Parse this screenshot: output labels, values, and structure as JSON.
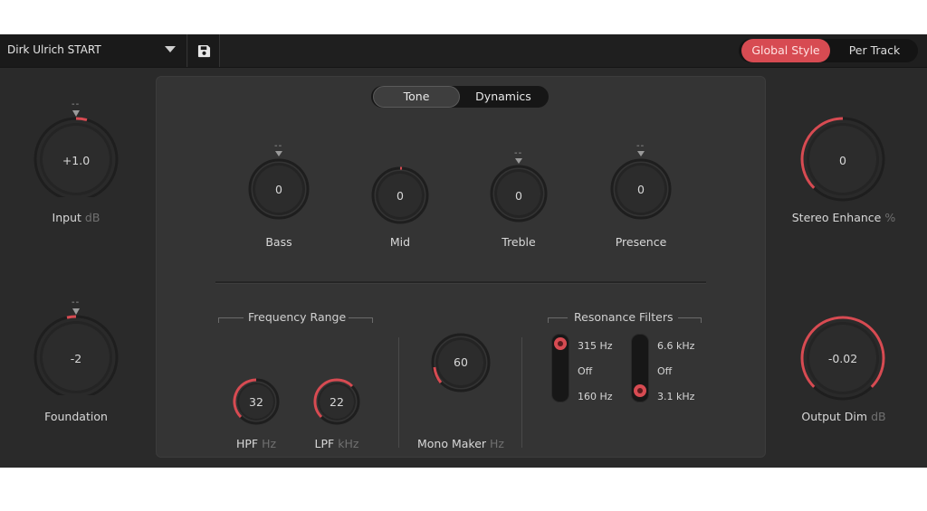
{
  "topbar": {
    "preset_name": "Dirk Ulrich START",
    "style_toggle": {
      "global_label": "Global Style",
      "per_track_label": "Per Track",
      "selected": "Global Style"
    }
  },
  "colors": {
    "accent": "#d74b52",
    "panel": "#2a2a2a",
    "center_panel": "#343434"
  },
  "icons": {
    "dropdown": "chevron-down-icon",
    "save": "floppy-disk-icon"
  },
  "center_tabs": {
    "tone_label": "Tone",
    "dynamics_label": "Dynamics",
    "selected": "Tone"
  },
  "knobs": {
    "input": {
      "value": "+1.0",
      "label": "Input",
      "unit": "dB",
      "marker": "--"
    },
    "foundation": {
      "value": "-2",
      "label": "Foundation",
      "marker": "--"
    },
    "bass": {
      "value": "0",
      "label": "Bass",
      "marker": "--"
    },
    "mid": {
      "value": "0",
      "label": "Mid"
    },
    "treble": {
      "value": "0",
      "label": "Treble",
      "marker": "--"
    },
    "presence": {
      "value": "0",
      "label": "Presence",
      "marker": "--"
    },
    "stereo_enhance": {
      "value": "0",
      "label": "Stereo Enhance",
      "unit": "%"
    },
    "output_dim": {
      "value": "-0.02",
      "label": "Output Dim",
      "unit": "dB"
    },
    "hpf": {
      "value": "32",
      "label": "HPF",
      "unit": "Hz"
    },
    "lpf": {
      "value": "22",
      "label": "LPF",
      "unit": "kHz"
    },
    "mono_maker": {
      "value": "60",
      "label": "Mono Maker",
      "unit": "Hz"
    }
  },
  "groups": {
    "frequency_range": "Frequency Range",
    "resonance_filters": "Resonance Filters"
  },
  "resonance": {
    "low_switch": {
      "top": "315 Hz",
      "middle": "Off",
      "bottom": "160 Hz",
      "selected": "315 Hz"
    },
    "high_switch": {
      "top": "6.6 kHz",
      "middle": "Off",
      "bottom": "3.1 kHz",
      "selected": "3.1 kHz"
    }
  }
}
